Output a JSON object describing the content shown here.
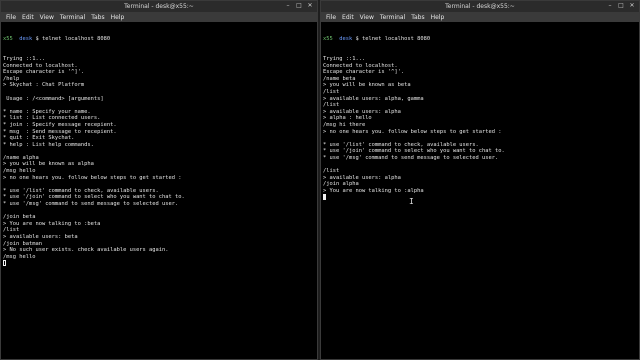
{
  "left": {
    "title": "Terminal - desk@x55:~",
    "menu": [
      "File",
      "Edit",
      "View",
      "Terminal",
      "Tabs",
      "Help"
    ],
    "prompt": {
      "user": "x55",
      "host": "desk",
      "cmd": "$ telnet localhost 8080"
    },
    "lines": [
      "Trying ::1...",
      "Connected to localhost.",
      "Escape character is '^]'.",
      "/help",
      "> Skychat : Chat Platform",
      "",
      " Usage : /<command> [arguments]",
      "",
      "* name : Specify your name.",
      "* list : List connected users.",
      "* join : Specify message recepient.",
      "* msg  : Send message to recepient.",
      "* quit : Exit Skychat.",
      "* help : List help commands.",
      "",
      "/name alpha",
      "> you will be known as alpha",
      "/msg hello",
      "> no one hears you. follow below steps to get started :",
      "",
      "* use '/list' command to check, available users.",
      "* use '/join' command to select who you want to chat to.",
      "* use '/msg' command to send message to selected user.",
      "",
      "/join beta",
      "> You are now talking to :beta",
      "/list",
      "> available users: beta",
      "/join batman",
      "> No such user exists. check available users again.",
      "/msg hello"
    ]
  },
  "right": {
    "title": "Terminal - desk@x55:~",
    "menu": [
      "File",
      "Edit",
      "View",
      "Terminal",
      "Tabs",
      "Help"
    ],
    "prompt": {
      "user": "x55",
      "host": "desk",
      "cmd": "$ telnet localhost 8080"
    },
    "lines": [
      "Trying ::1...",
      "Connected to localhost.",
      "Escape character is '^]'.",
      "/name beta",
      "> you will be known as beta",
      "/list",
      "> available users: alpha, gamma",
      "/list",
      "> available users: alpha",
      "> alpha : hello",
      "/msg hi there",
      "> no one hears you. follow below steps to get started :",
      "",
      "* use '/list' command to check, available users.",
      "* use '/join' command to select who you want to chat to.",
      "* use '/msg' command to send message to selected user.",
      "",
      "/list",
      "> available users: alpha",
      "/join alpha",
      "> You are now talking to :alpha"
    ]
  },
  "window_buttons": [
    "–",
    "□",
    "✕"
  ],
  "icons": {
    "pointer": "mouse-pointer-icon"
  }
}
